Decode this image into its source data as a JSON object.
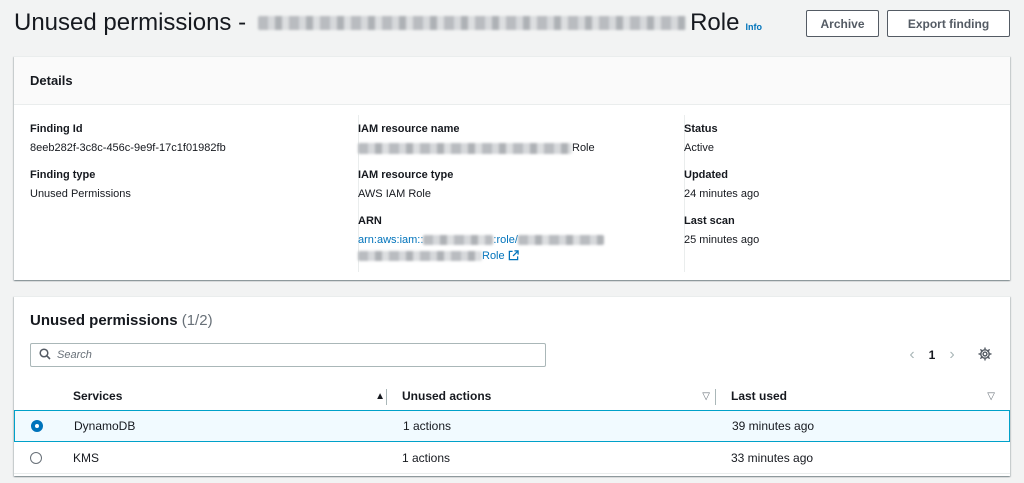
{
  "header": {
    "title_prefix": "Unused permissions -",
    "title_suffix": "Role",
    "info_label": "Info",
    "archive_label": "Archive",
    "export_label": "Export finding"
  },
  "details": {
    "heading": "Details",
    "finding_id_label": "Finding Id",
    "finding_id": "8eeb282f-3c8c-456c-9e9f-17c1f01982fb",
    "finding_type_label": "Finding type",
    "finding_type": "Unused Permissions",
    "resource_name_label": "IAM resource name",
    "resource_name_suffix": "Role",
    "resource_type_label": "IAM resource type",
    "resource_type": "AWS IAM Role",
    "arn_label": "ARN",
    "arn_prefix": "arn:aws:iam::",
    "arn_mid": ":role/",
    "arn_suffix": "Role",
    "status_label": "Status",
    "status": "Active",
    "updated_label": "Updated",
    "updated": "24 minutes ago",
    "last_scan_label": "Last scan",
    "last_scan": "25 minutes ago"
  },
  "permissions": {
    "title": "Unused permissions",
    "count": "(1/2)",
    "search_placeholder": "Search",
    "page": "1",
    "prev_icon": "‹",
    "next_icon": "›",
    "columns": {
      "services": "Services",
      "unused_actions": "Unused actions",
      "last_used": "Last used"
    },
    "rows": [
      {
        "service": "DynamoDB",
        "unused_actions": "1 actions",
        "last_used": "39 minutes ago",
        "selected": true
      },
      {
        "service": "KMS",
        "unused_actions": "1 actions",
        "last_used": "33 minutes ago",
        "selected": false
      }
    ]
  },
  "colors": {
    "accent": "#0073bb",
    "selected_row_bg": "#f1faff",
    "selected_row_border": "#00a1c9",
    "page_bg": "#f2f3f3"
  }
}
